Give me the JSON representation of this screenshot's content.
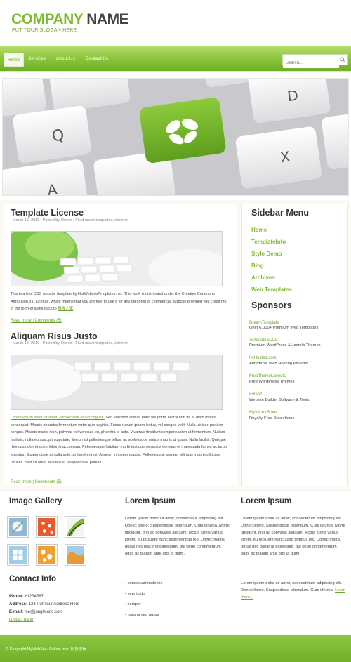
{
  "header": {
    "company_green": "COMPANY",
    "company_dark": " NAME",
    "slogan": "PUT YOUR SLOGAN HERE"
  },
  "nav": {
    "items": [
      "Home",
      "Services",
      "About Us",
      "Contact Us"
    ],
    "search_placeholder": "Search...",
    "search_icon": "search-icon"
  },
  "posts": [
    {
      "title": "Template License",
      "meta": "March 16, 2010 | Posted by Owner | Filed under templates, internet",
      "body": "This is a free CSS website template by HotWebsiteTemplates.net. This work is distributed under the Creative Commons Attribution 3.0 License, which means that you are free to use it for any personal or commercial purpose provided you credit me in the form of a link back to ",
      "body_link": "模板之家",
      "read_more": "Read more | Comments (5)"
    },
    {
      "title": "Aliquam Risus Justo",
      "meta": "March 16, 2010 | Posted by Owner | Filed under templates, internet",
      "body_link": "Lorem ipsum dolor sit amet, consectetur adipiscing elit.",
      "body": " Sed euismod aliquet nunc vel porta. Morbi non mi et diam mattis consequat. Mauris pharetra fermentum tortor quis sagittis. Fusce rutrum ipsum lectus, vel congue velit. Nulla ultrices pretium congue. Mauris mattis nibh, pulvinar vel vehicula eu, pharetra id ante. Vivamus tincidunt semper sapien ut fermentum. Nullam facilisis, nulla eu suscipit vulputate, libero nisl pellentesque tellus, ac scelerisque metus mauris ut quam. Nulla facilisi. Quisque rhoncus dolor et dolor lobortis accumsan. Pellentesque habitant morbi tristique senectus et netus et malesuada fames ac turpis egestas. Suspendisse at nulla ante, at hendrerit mi. Aenean in ipsum massa. Pellentesque semper elit quis mauris ultricies ultrices. Sed sit amet felis tellus. Suspendisse potenti.",
      "read_more": "Read more | Comments (5)"
    }
  ],
  "sidebar": {
    "menu_title": "Sidebar Menu",
    "menu_items": [
      "Home",
      "TemplateInfo",
      "Style Demo",
      "Blog",
      "Archives",
      "Web Templates"
    ],
    "sponsors_title": "Sponsors",
    "sponsors": [
      {
        "name": "DreamTemplate",
        "desc": "Over 6,000+ Premium Web Templates"
      },
      {
        "name": "TemplateSOLD",
        "desc": "Premium WordPress & Joomla Themes"
      },
      {
        "name": "ImHosted.com",
        "desc": "Affordable Web Hosting Provider"
      },
      {
        "name": "FreeThemeLayouts",
        "desc": "Free WordPress Themes"
      },
      {
        "name": "Evisoft",
        "desc": "Website Builder Software & Tools"
      },
      {
        "name": "MyVectorStore",
        "desc": "Royalty Free Stock Icons"
      }
    ]
  },
  "gallery": {
    "title": "Image Gallery",
    "thumb_colors": [
      "#8fb8d8",
      "#e85a2a",
      "#7dbb2e",
      "#9fcfe8",
      "#f0a030",
      "#e89a3a"
    ]
  },
  "contact": {
    "title": "Contact Info",
    "phone_label": "Phone:",
    "phone": " +1234567",
    "address_label": "Address:",
    "address": " 123 Put Your Address Here",
    "email_label": "E-mail:",
    "email": " me@jungleland.com",
    "contact_page": "contact page"
  },
  "lorem1": {
    "title": "Lorem Ipsum",
    "text": "Lorem ipsum dolor sit amet, consectetur adipiscing elit. Donec libero. Suspendisse bibendum. Cras id urna. Morbi tincidunt, orci ac convallis aliquam, lectus turpis varius lorem, eu posuere nunc justo tempus leo. Donec mattis, purus nec placerat bibendum, dui pede condimentum odio, ac blandit ante orci ut diam.",
    "bullets": [
      "consequat molestie",
      "sem justo",
      "semper",
      "magna sed purus"
    ]
  },
  "lorem2": {
    "title": "Lorem Ipsum",
    "text1": "Lorem ipsum dolor sit amet, consectetuer adipiscing elit. Donec libero. Suspendisse bibendum. Cras id urna. Morbi tincidunt, orci ac convallis aliquam, lectus turpis varius lorem, eu posuere nunc justo tempus leo. Donec mattis, purus nec placerat bibendum, dui pede condimentum odio, ac blandit ante orci ut diam.",
    "text2": "Lorem ipsum dolor sit amet, consectetuer adipiscing elit. Donec libero. Suspendisse bibendum. Cras id urna. ",
    "learn_more": "Learn more..."
  },
  "footer": {
    "copyright": "© Copyright MyWebSite. Collect from ",
    "link": "网页模板"
  },
  "colors": {
    "accent": "#7dbb2e",
    "accent_dark": "#6aa12a",
    "nav_top": "#b6dc6a",
    "nav_bottom": "#6fae24"
  }
}
